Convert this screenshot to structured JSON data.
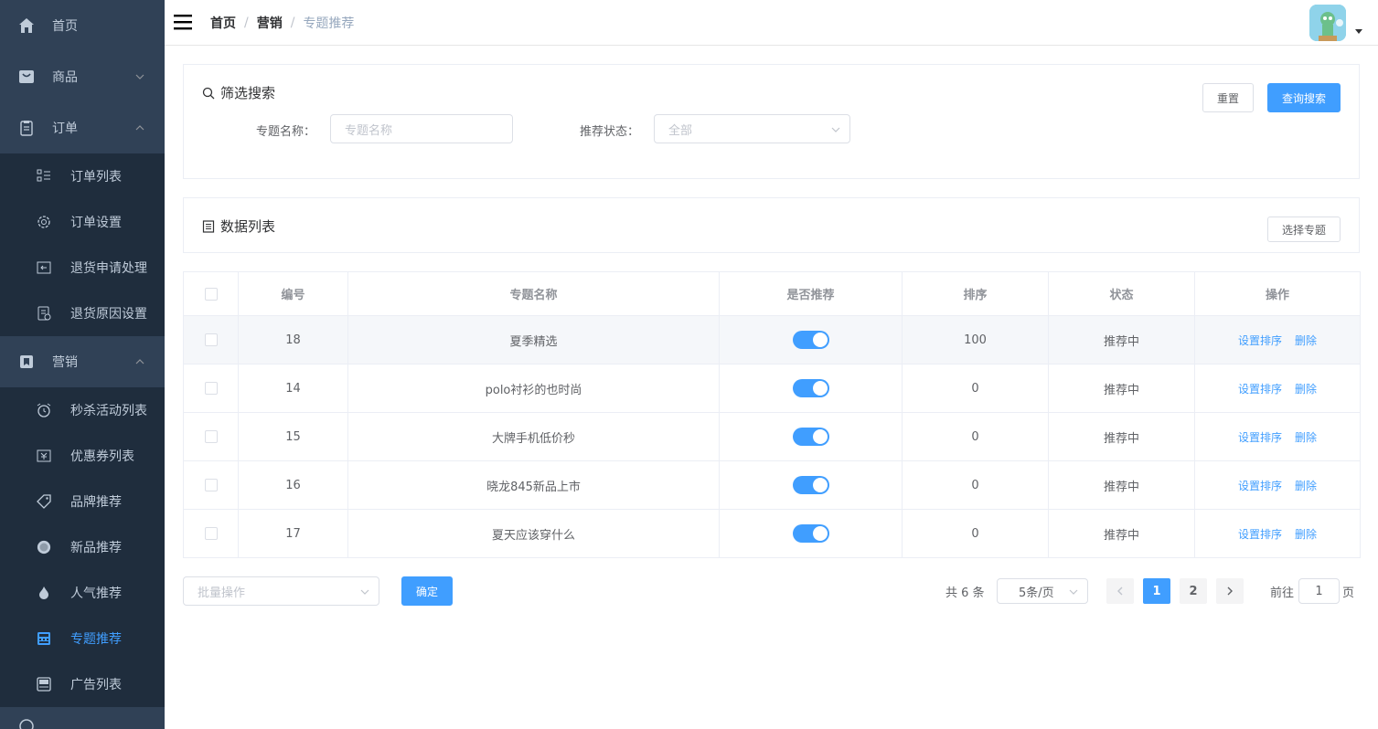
{
  "sidebar": {
    "home": "首页",
    "product": "商品",
    "order": "订单",
    "order_items": [
      "订单列表",
      "订单设置",
      "退货申请处理",
      "退货原因设置"
    ],
    "marketing": "营销",
    "marketing_items": [
      "秒杀活动列表",
      "优惠券列表",
      "品牌推荐",
      "新品推荐",
      "人气推荐",
      "专题推荐",
      "广告列表"
    ],
    "active_item": "专题推荐"
  },
  "header": {
    "breadcrumb": [
      "首页",
      "营销",
      "专题推荐"
    ]
  },
  "filter": {
    "title": "筛选搜索",
    "reset_label": "重置",
    "search_label": "查询搜索",
    "name_label": "专题名称：",
    "name_placeholder": "专题名称",
    "status_label": "推荐状态：",
    "status_value": "全部"
  },
  "list": {
    "title": "数据列表",
    "select_button": "选择专题"
  },
  "table": {
    "columns": [
      "编号",
      "专题名称",
      "是否推荐",
      "排序",
      "状态",
      "操作"
    ],
    "rows": [
      {
        "id": "18",
        "name": "夏季精选",
        "recommended": true,
        "sort": "100",
        "status": "推荐中"
      },
      {
        "id": "14",
        "name": "polo衬衫的也时尚",
        "recommended": true,
        "sort": "0",
        "status": "推荐中"
      },
      {
        "id": "15",
        "name": "大牌手机低价秒",
        "recommended": true,
        "sort": "0",
        "status": "推荐中"
      },
      {
        "id": "16",
        "name": "晓龙845新品上市",
        "recommended": true,
        "sort": "0",
        "status": "推荐中"
      },
      {
        "id": "17",
        "name": "夏天应该穿什么",
        "recommended": true,
        "sort": "0",
        "status": "推荐中"
      }
    ],
    "action_sort": "设置排序",
    "action_delete": "删除"
  },
  "batch": {
    "placeholder": "批量操作",
    "confirm_label": "确定"
  },
  "pagination": {
    "total_text": "共 6 条",
    "page_size": "5条/页",
    "pages": [
      "1",
      "2"
    ],
    "current_page": "1",
    "goto_prefix": "前往",
    "goto_value": "1",
    "goto_suffix": "页"
  },
  "colors": {
    "sidebar_bg": "#304156",
    "submenu_bg": "#1f2d3d",
    "primary": "#409eff"
  }
}
